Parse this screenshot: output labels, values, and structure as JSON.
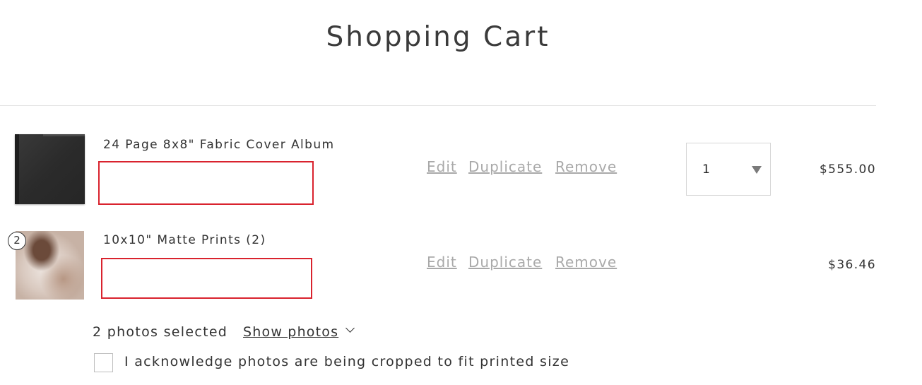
{
  "page": {
    "title": "Shopping Cart"
  },
  "cart": {
    "items": [
      {
        "name": "24 Page 8x8\" Fabric Cover Album",
        "actions": {
          "edit": "Edit",
          "duplicate": "Duplicate",
          "remove": "Remove"
        },
        "quantity": "1",
        "price": "$555.00",
        "thumbnail": "album-cover-image"
      },
      {
        "name": "10x10\" Matte Prints (2)",
        "badge": "2",
        "actions": {
          "edit": "Edit",
          "duplicate": "Duplicate",
          "remove": "Remove"
        },
        "price": "$36.46",
        "thumbnail": "wedding-photo-image"
      }
    ],
    "photos": {
      "selected_text": "2 photos selected",
      "show_label": "Show photos",
      "icon": "chevron-down-icon"
    },
    "acknowledge": {
      "label": "I acknowledge photos are being cropped to fit printed size",
      "checked": false
    }
  },
  "colors": {
    "text": "#333333",
    "action_link": "#a9a9a9",
    "redaction_border": "#d9232e",
    "divider": "#e2e2e2"
  }
}
